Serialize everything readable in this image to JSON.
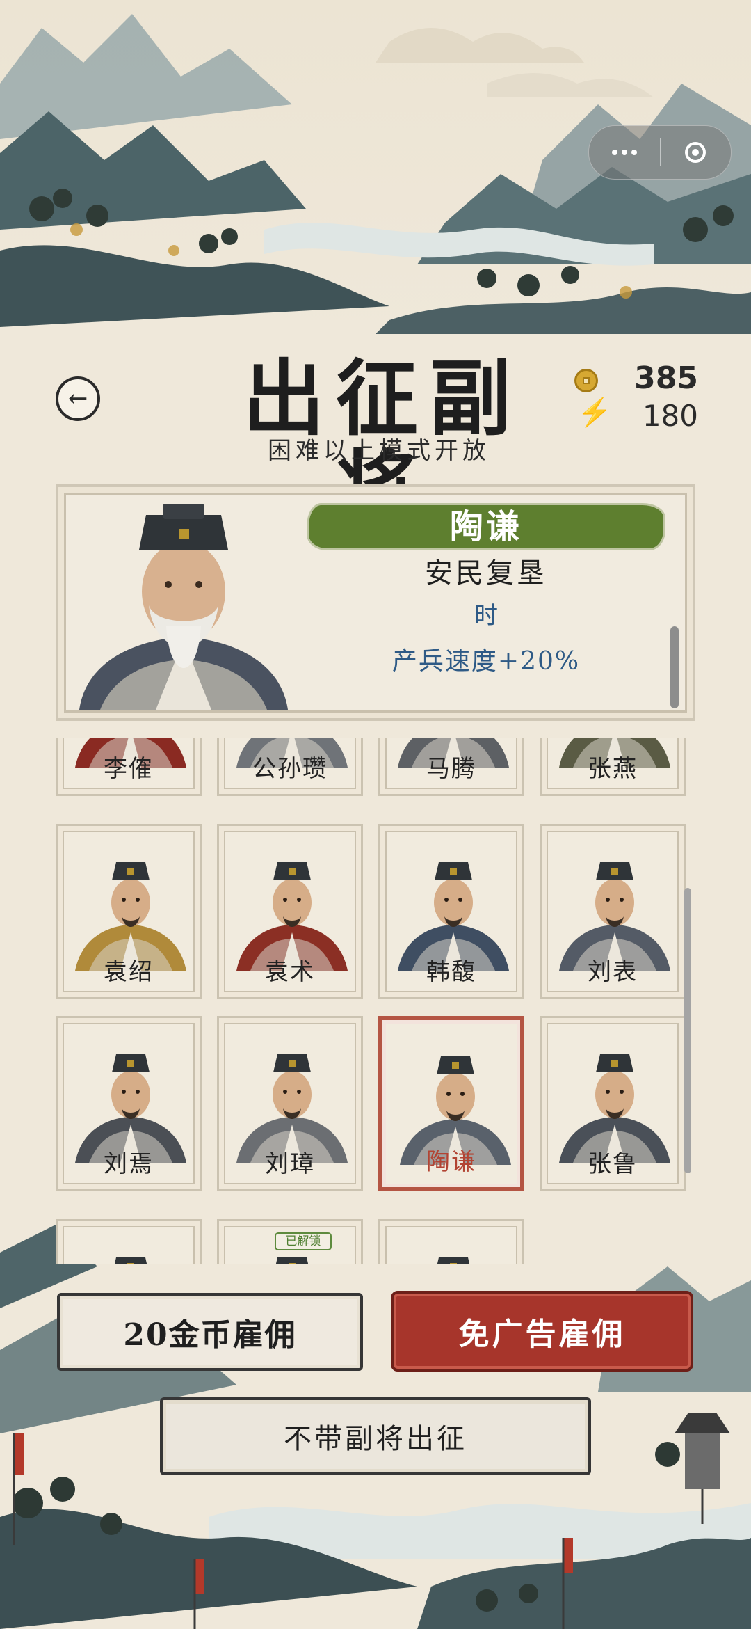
{
  "header": {
    "title": "出征副将",
    "subtitle": "困难以上模式开放",
    "gold": "385",
    "energy": "180"
  },
  "detail": {
    "name": "陶谦",
    "skill": "安民复垦",
    "period": "时",
    "effect": "产兵速度+20%"
  },
  "heroes": [
    {
      "name": "李傕",
      "robe": "#8a2a22"
    },
    {
      "name": "公孙瓒",
      "robe": "#6f7378"
    },
    {
      "name": "马腾",
      "robe": "#5d6064"
    },
    {
      "name": "张燕",
      "robe": "#5a5b44"
    },
    {
      "name": "袁绍",
      "robe": "#b08a3a"
    },
    {
      "name": "袁术",
      "robe": "#8b2f24"
    },
    {
      "name": "韩馥",
      "robe": "#3f4e62"
    },
    {
      "name": "刘表",
      "robe": "#545b66"
    },
    {
      "name": "刘焉",
      "robe": "#4b4f55"
    },
    {
      "name": "刘璋",
      "robe": "#6b6e72"
    },
    {
      "name": "陶谦",
      "robe": "#59616b"
    },
    {
      "name": "张鲁",
      "robe": "#4a5058"
    },
    {
      "name": "",
      "robe": "#7a7a7a"
    },
    {
      "name": "",
      "robe": "#7a7a7a"
    },
    {
      "name": "",
      "robe": "#7a7a7a"
    }
  ],
  "badge": {
    "unlocked": "已解锁"
  },
  "buttons": {
    "gold_hire": "20金币雇佣",
    "ad_hire": "免广告雇佣",
    "no_general": "不带副将出征"
  },
  "colors": {
    "accent_red": "#a7352b",
    "banner_green": "#5e7f2f",
    "effect_blue": "#2e5a86"
  }
}
